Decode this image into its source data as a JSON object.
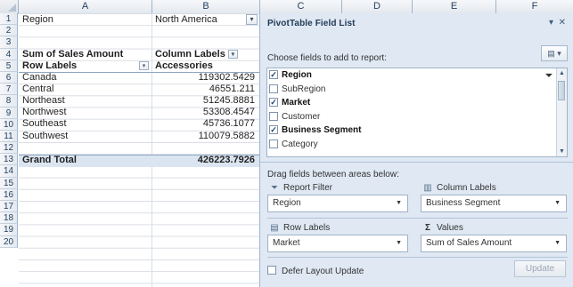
{
  "columns": [
    "A",
    "B",
    "C",
    "D",
    "E",
    "F"
  ],
  "rows": [
    "1",
    "2",
    "3",
    "4",
    "5",
    "6",
    "7",
    "8",
    "9",
    "10",
    "11",
    "12",
    "13",
    "14",
    "15",
    "16",
    "17",
    "18",
    "19",
    "20"
  ],
  "sheet": {
    "filter_label": "Region",
    "filter_value": "North America",
    "sum_label": "Sum of Sales Amount",
    "column_labels": "Column Labels",
    "row_labels": "Row Labels",
    "col_item": "Accessories",
    "data_rows": [
      {
        "label": "Canada",
        "value": "119302.5429"
      },
      {
        "label": "Central",
        "value": "46551.211"
      },
      {
        "label": "Northeast",
        "value": "51245.8881"
      },
      {
        "label": "Northwest",
        "value": "53308.4547"
      },
      {
        "label": "Southeast",
        "value": "45736.1077"
      },
      {
        "label": "Southwest",
        "value": "110079.5882"
      }
    ],
    "grand_total_label": "Grand Total",
    "grand_total_value": "426223.7926"
  },
  "pivot_panel": {
    "title": "PivotTable Field List",
    "subtitle": "Choose fields to add to report:",
    "fields": [
      {
        "name": "Region",
        "checked": true
      },
      {
        "name": "SubRegion",
        "checked": false
      },
      {
        "name": "Market",
        "checked": true
      },
      {
        "name": "Customer",
        "checked": false
      },
      {
        "name": "Business Segment",
        "checked": true
      },
      {
        "name": "Category",
        "checked": false
      }
    ],
    "drag_hint": "Drag fields between areas below:",
    "areas": {
      "report_filter": {
        "label": "Report Filter",
        "item": "Region",
        "icon": "filter-icon"
      },
      "column_labels": {
        "label": "Column Labels",
        "item": "Business Segment",
        "icon": "columns-icon"
      },
      "row_labels": {
        "label": "Row Labels",
        "item": "Market",
        "icon": "rows-icon"
      },
      "values": {
        "label": "Values",
        "item": "Sum of Sales Amount",
        "icon": "sigma-icon"
      }
    },
    "defer_label": "Defer Layout Update",
    "update_label": "Update"
  },
  "colors": {
    "panel_bg": "#dfe8f3",
    "header_text": "#27415f",
    "grand_total_band": "#dbe5f1"
  }
}
